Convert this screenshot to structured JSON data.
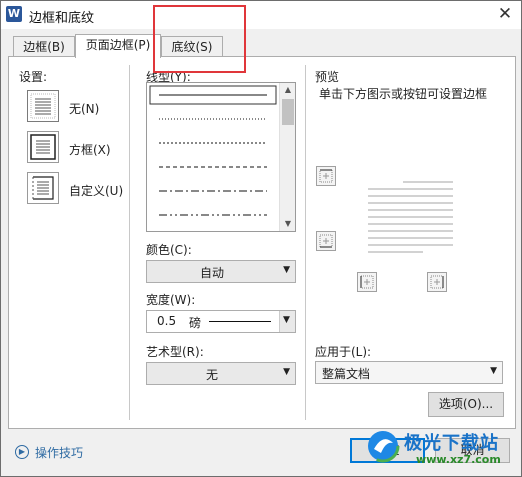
{
  "window": {
    "title": "边框和底纹",
    "app_icon": "W",
    "close_label": "✕"
  },
  "tabs": [
    {
      "label": "边框(B)",
      "active": false
    },
    {
      "label": "页面边框(P)",
      "active": true
    },
    {
      "label": "底纹(S)",
      "active": false
    }
  ],
  "settings": {
    "heading": "设置:",
    "options": [
      {
        "label": "无(N)",
        "icon": "no-border-icon"
      },
      {
        "label": "方框(X)",
        "icon": "box-border-icon"
      },
      {
        "label": "自定义(U)",
        "icon": "custom-border-icon"
      }
    ]
  },
  "line_style": {
    "label": "线型(Y):",
    "styles": [
      "solid",
      "dotted",
      "dashed-small",
      "dashed",
      "dash-dot",
      "dash-dot-dot"
    ]
  },
  "color": {
    "label": "颜色(C):",
    "value": "自动"
  },
  "width": {
    "label": "宽度(W):",
    "value": "0.5",
    "unit": "磅"
  },
  "art": {
    "label": "艺术型(R):",
    "value": "无"
  },
  "preview": {
    "heading": "预览",
    "hint": "单击下方图示或按钮可设置边框"
  },
  "apply_to": {
    "label": "应用于(L):",
    "value": "整篇文档"
  },
  "buttons": {
    "options": "选项(O)...",
    "ok": "确定",
    "cancel": "取消"
  },
  "tips_link": "操作技巧",
  "watermark": {
    "brand": "极光下载站",
    "url": "www.xz7.com"
  },
  "colors": {
    "accent_red": "#e0363a",
    "link_blue": "#2f6ba3",
    "ok_border": "#0078d7"
  }
}
